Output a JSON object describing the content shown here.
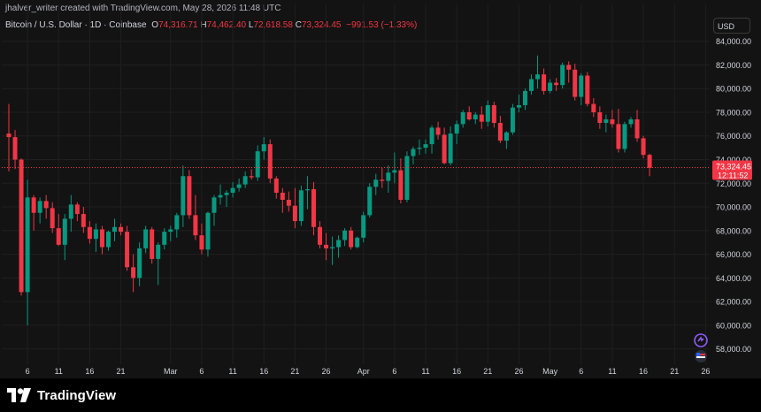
{
  "header": {
    "attribution": "jhalver_writer created with TradingView.com, May 28, 2026 11:48 UTC",
    "symbol": "Bitcoin / U.S. Dollar · 1D · Coinbase",
    "open_label": "O",
    "open_value": "74,316.71",
    "high_label": "H",
    "high_value": "74,462.40",
    "low_label": "L",
    "low_value": "72,618.58",
    "close_label": "C",
    "close_value": "73,324.45",
    "change": "−991.53 (−1.33%)",
    "currency_button": "USD"
  },
  "price_tag": {
    "price": "73,324.45",
    "countdown": "12:11:52"
  },
  "footer": {
    "logo_text": "TradingView"
  },
  "colors": {
    "background": "#131313",
    "up": "#089981",
    "down": "#f23645",
    "grid": "#1f1f1f",
    "axis_text": "#d1d4dc"
  },
  "icons": [
    "tradingview-logo-icon",
    "indicator-swap-icon",
    "flag-icon"
  ],
  "chart_data": {
    "type": "candlestick",
    "title": "Bitcoin / U.S. Dollar · 1D · Coinbase",
    "xlabel": "",
    "ylabel": "",
    "ylim": [
      57000,
      84500
    ],
    "y_ticks": [
      "84,000.00",
      "82,000.00",
      "80,000.00",
      "78,000.00",
      "76,000.00",
      "74,000.00",
      "72,000.00",
      "70,000.00",
      "68,000.00",
      "66,000.00",
      "64,000.00",
      "62,000.00",
      "60,000.00",
      "58,000.00"
    ],
    "x_ticks": [
      {
        "label": "6",
        "index": 3
      },
      {
        "label": "11",
        "index": 8
      },
      {
        "label": "16",
        "index": 13
      },
      {
        "label": "21",
        "index": 18
      },
      {
        "label": "Mar",
        "index": 26
      },
      {
        "label": "6",
        "index": 31
      },
      {
        "label": "11",
        "index": 36
      },
      {
        "label": "16",
        "index": 41
      },
      {
        "label": "21",
        "index": 46
      },
      {
        "label": "26",
        "index": 51
      },
      {
        "label": "Apr",
        "index": 57
      },
      {
        "label": "6",
        "index": 62
      },
      {
        "label": "11",
        "index": 67
      },
      {
        "label": "16",
        "index": 72
      },
      {
        "label": "21",
        "index": 77
      },
      {
        "label": "26",
        "index": 82
      },
      {
        "label": "May",
        "index": 87
      },
      {
        "label": "6",
        "index": 92
      },
      {
        "label": "11",
        "index": 97
      },
      {
        "label": "16",
        "index": 102
      },
      {
        "label": "21",
        "index": 107
      },
      {
        "label": "26",
        "index": 112
      }
    ],
    "last_price_line": 73324.45,
    "grid": true,
    "series": [
      {
        "candles": [
          [
            76200,
            78700,
            73000,
            75900
          ],
          [
            75900,
            76500,
            73200,
            74000
          ],
          [
            74000,
            74100,
            62500,
            62800
          ],
          [
            62800,
            72300,
            60000,
            70800
          ],
          [
            70800,
            71000,
            68000,
            69500
          ],
          [
            69500,
            70800,
            68600,
            70500
          ],
          [
            70500,
            71000,
            69000,
            69900
          ],
          [
            69900,
            70400,
            67800,
            68200
          ],
          [
            68200,
            69400,
            66700,
            66800
          ],
          [
            66800,
            69400,
            65500,
            69000
          ],
          [
            69000,
            71000,
            67900,
            70200
          ],
          [
            70200,
            70400,
            68800,
            69400
          ],
          [
            69400,
            70000,
            67800,
            68300
          ],
          [
            68300,
            68800,
            66900,
            67300
          ],
          [
            67300,
            68600,
            66200,
            68100
          ],
          [
            68100,
            68400,
            66000,
            66600
          ],
          [
            66600,
            68000,
            66300,
            67900
          ],
          [
            67900,
            69000,
            67100,
            68300
          ],
          [
            68300,
            68600,
            67600,
            67900
          ],
          [
            67900,
            68400,
            64600,
            64900
          ],
          [
            64900,
            66000,
            62800,
            64000
          ],
          [
            64000,
            67000,
            63300,
            66500
          ],
          [
            66500,
            68400,
            66100,
            68100
          ],
          [
            68100,
            68300,
            65200,
            65600
          ],
          [
            65600,
            67000,
            63400,
            66800
          ],
          [
            66800,
            68200,
            66400,
            67900
          ],
          [
            67900,
            68400,
            67100,
            68100
          ],
          [
            68100,
            69500,
            67400,
            69300
          ],
          [
            69300,
            73500,
            68300,
            72600
          ],
          [
            72600,
            73100,
            69000,
            69300
          ],
          [
            69300,
            71000,
            67200,
            67600
          ],
          [
            67600,
            68600,
            66000,
            66400
          ],
          [
            66400,
            69600,
            65800,
            69500
          ],
          [
            69500,
            71000,
            68400,
            70800
          ],
          [
            70800,
            71900,
            70200,
            71000
          ],
          [
            71000,
            71400,
            70000,
            71200
          ],
          [
            71200,
            72100,
            70800,
            71600
          ],
          [
            71600,
            72400,
            71300,
            71900
          ],
          [
            71900,
            73000,
            71600,
            72600
          ],
          [
            72600,
            73200,
            72300,
            72500
          ],
          [
            72500,
            75200,
            72200,
            74700
          ],
          [
            74700,
            75900,
            74000,
            75300
          ],
          [
            75300,
            75700,
            72000,
            72400
          ],
          [
            72400,
            72600,
            70700,
            71200
          ],
          [
            71200,
            71600,
            69500,
            70600
          ],
          [
            70600,
            71300,
            69600,
            70100
          ],
          [
            70100,
            71600,
            68200,
            68800
          ],
          [
            68800,
            71800,
            68400,
            71400
          ],
          [
            71400,
            72600,
            69800,
            71500
          ],
          [
            71500,
            72100,
            67600,
            68300
          ],
          [
            68300,
            68800,
            66500,
            66800
          ],
          [
            66800,
            67800,
            65500,
            66500
          ],
          [
            66500,
            67500,
            65100,
            66600
          ],
          [
            66600,
            67600,
            65700,
            67200
          ],
          [
            67200,
            68200,
            66700,
            68000
          ],
          [
            68000,
            68300,
            66400,
            66600
          ],
          [
            66600,
            67500,
            66500,
            67400
          ],
          [
            67400,
            69600,
            67000,
            69300
          ],
          [
            69300,
            72000,
            69100,
            71700
          ],
          [
            71700,
            72800,
            71000,
            72300
          ],
          [
            72300,
            73300,
            71600,
            72200
          ],
          [
            72200,
            73500,
            71200,
            72900
          ],
          [
            72900,
            74600,
            72000,
            73100
          ],
          [
            73100,
            74100,
            70300,
            70600
          ],
          [
            70600,
            74700,
            70400,
            74300
          ],
          [
            74300,
            75100,
            73600,
            74900
          ],
          [
            74900,
            75700,
            74400,
            75000
          ],
          [
            75000,
            75700,
            74500,
            75300
          ],
          [
            75300,
            76900,
            74500,
            76700
          ],
          [
            76700,
            77200,
            75700,
            76100
          ],
          [
            76100,
            76700,
            73600,
            73700
          ],
          [
            73700,
            76800,
            73500,
            76200
          ],
          [
            76200,
            77300,
            75300,
            77000
          ],
          [
            77000,
            78200,
            76700,
            78000
          ],
          [
            78000,
            78500,
            77300,
            77400
          ],
          [
            77400,
            78000,
            77000,
            77800
          ],
          [
            77800,
            78500,
            76600,
            77200
          ],
          [
            77200,
            79000,
            76800,
            78600
          ],
          [
            78600,
            78900,
            76700,
            77100
          ],
          [
            77100,
            77700,
            75400,
            75600
          ],
          [
            75600,
            76400,
            74900,
            76300
          ],
          [
            76300,
            78700,
            76100,
            78400
          ],
          [
            78400,
            79500,
            78000,
            78600
          ],
          [
            78600,
            80000,
            78200,
            79800
          ],
          [
            79800,
            81200,
            79500,
            80800
          ],
          [
            80800,
            82800,
            80000,
            81200
          ],
          [
            81200,
            81700,
            79500,
            79800
          ],
          [
            79800,
            80800,
            79600,
            80500
          ],
          [
            80500,
            80900,
            79800,
            80300
          ],
          [
            80300,
            82200,
            80000,
            82000
          ],
          [
            82000,
            82300,
            80500,
            81600
          ],
          [
            81600,
            82100,
            79000,
            79300
          ],
          [
            79300,
            81300,
            78600,
            81100
          ],
          [
            81100,
            81400,
            78500,
            78700
          ],
          [
            78700,
            79200,
            77600,
            78000
          ],
          [
            78000,
            78500,
            76600,
            77100
          ],
          [
            77100,
            77800,
            76300,
            77400
          ],
          [
            77400,
            78200,
            76700,
            77000
          ],
          [
            77000,
            78300,
            74600,
            74900
          ],
          [
            74900,
            77200,
            74600,
            77000
          ],
          [
            77000,
            77600,
            76700,
            77400
          ],
          [
            77400,
            78200,
            75500,
            75800
          ],
          [
            75800,
            76000,
            74100,
            74400
          ],
          [
            74400,
            74500,
            72600,
            73300
          ]
        ]
      }
    ]
  }
}
